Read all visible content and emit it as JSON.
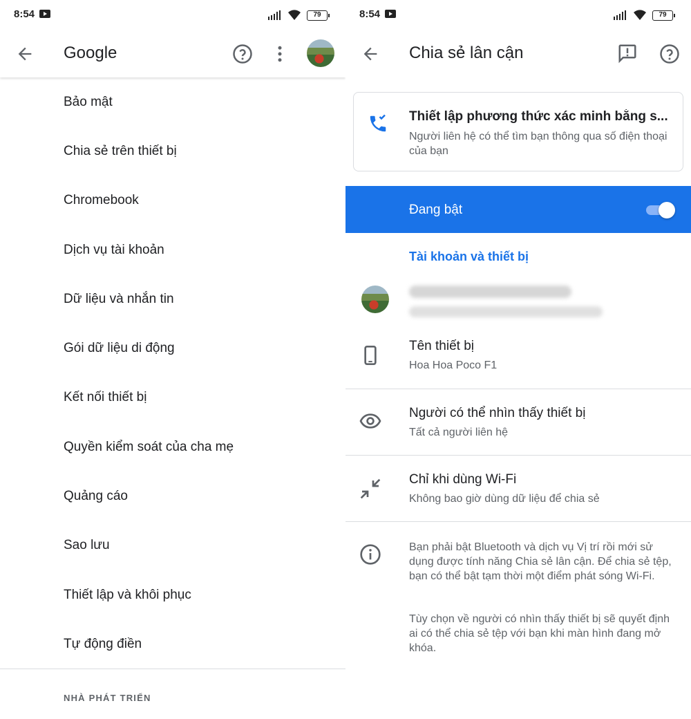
{
  "status": {
    "time": "8:54",
    "battery": "79"
  },
  "left": {
    "title": "Google",
    "menu": [
      "Bảo mật",
      "Chia sẻ trên thiết bị",
      "Chromebook",
      "Dịch vụ tài khoản",
      "Dữ liệu và nhắn tin",
      "Gói dữ liệu di động",
      "Kết nối thiết bị",
      "Quyền kiểm soát của cha mẹ",
      "Quảng cáo",
      "Sao lưu",
      "Thiết lập và khôi phục",
      "Tự động điền"
    ],
    "section": "NHÀ PHÁT TRIỂN"
  },
  "right": {
    "title": "Chia sẻ lân cận",
    "card": {
      "title": "Thiết lập phương thức xác minh bằng s...",
      "subtitle": "Người liên hệ có thể tìm bạn thông qua số điện thoại của bạn"
    },
    "toggle_label": "Đang bật",
    "toggle_on": true,
    "account_header": "Tài khoản và thiết bị",
    "device_name": {
      "title": "Tên thiết bị",
      "value": "Hoa Hoa Poco F1"
    },
    "visibility": {
      "title": "Người có thể nhìn thấy thiết bị",
      "value": "Tất cả người liên hệ"
    },
    "data_usage": {
      "title": "Chỉ khi dùng Wi-Fi",
      "value": "Không bao giờ dùng dữ liệu để chia sẻ"
    },
    "info": [
      "Bạn phải bật Bluetooth và dịch vụ Vị trí rồi mới sử dụng được tính năng Chia sẻ lân cận. Để chia sẻ tệp, bạn có thể bật tạm thời một điểm phát sóng Wi-Fi.",
      "Tùy chọn về người có nhìn thấy thiết bị sẽ quyết định ai có thể chia sẻ tệp với bạn khi màn hình đang mở khóa."
    ],
    "colors": {
      "accent": "#1a73e8"
    }
  },
  "icons": [
    "back-arrow-icon",
    "help-icon",
    "more-vert-icon",
    "feedback-icon",
    "phone-verify-icon",
    "smartphone-icon",
    "eye-icon",
    "compress-arrows-icon",
    "info-icon"
  ]
}
